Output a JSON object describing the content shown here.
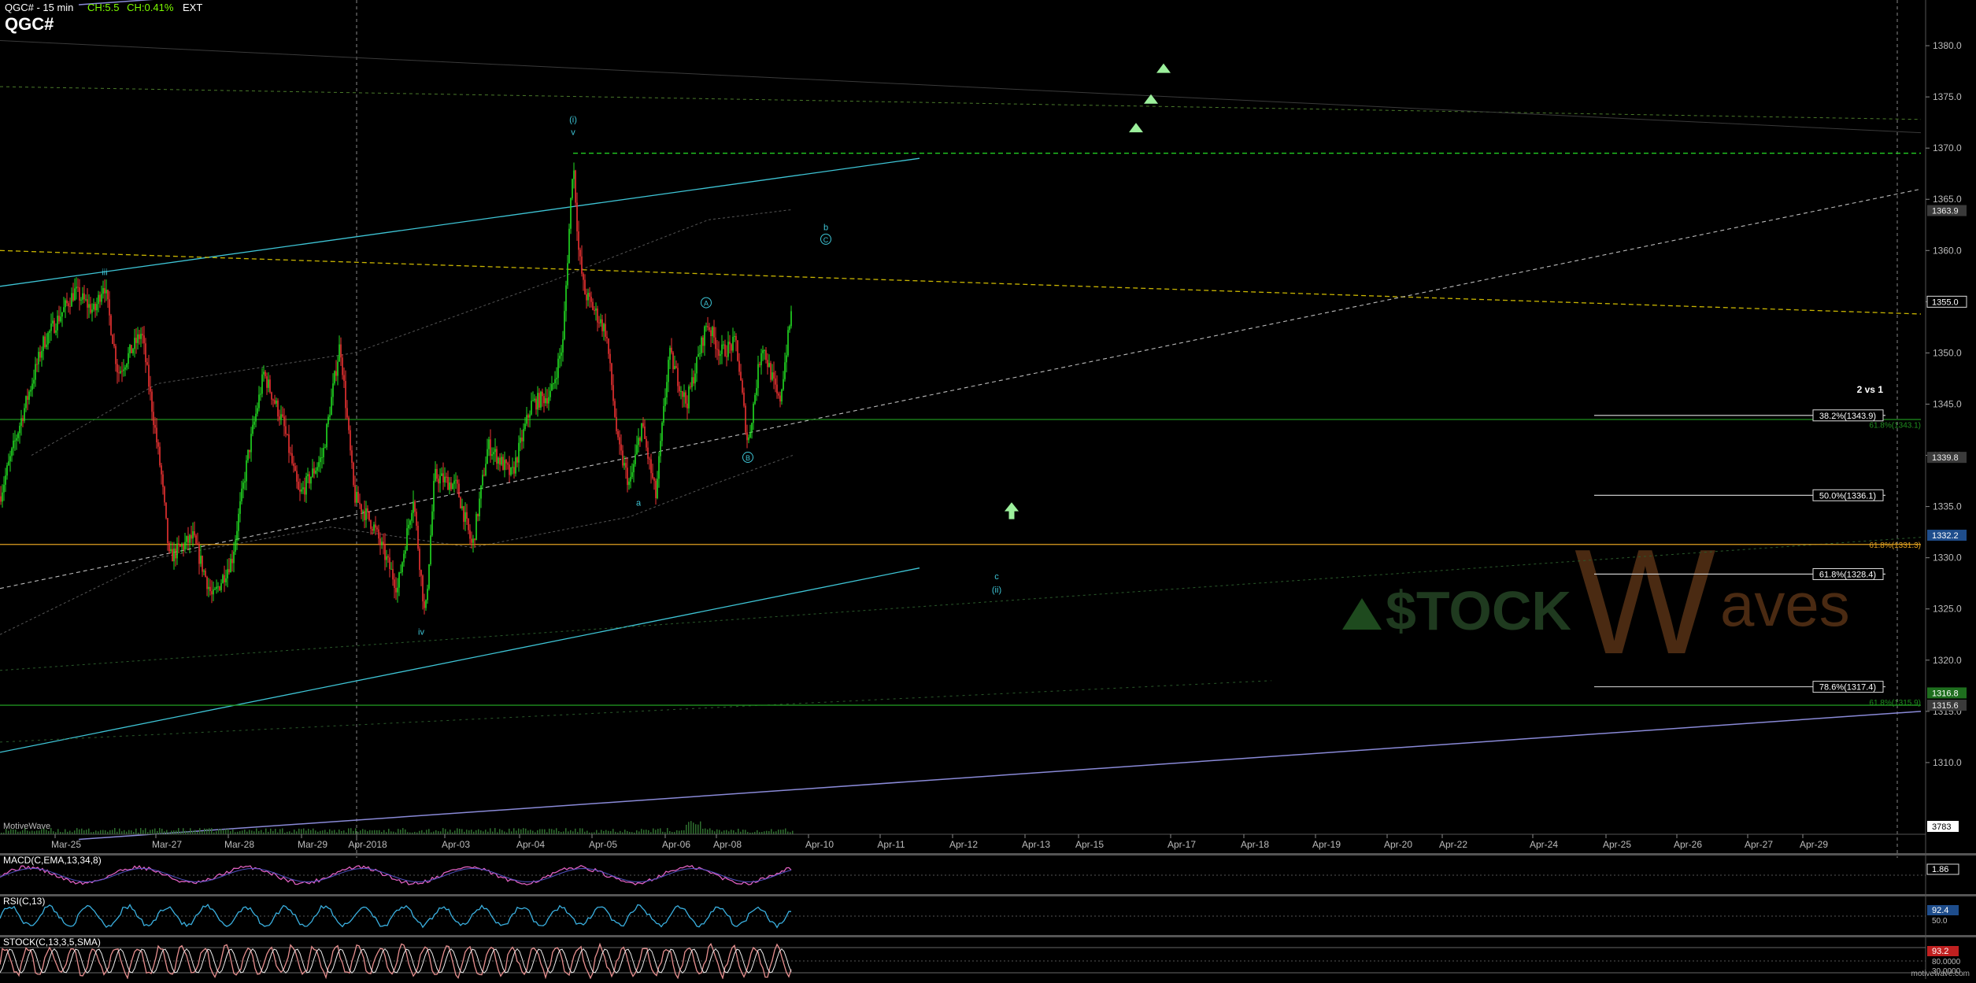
{
  "header": {
    "instrument": "QGC# - 15 min",
    "change_abs": "CH:5.5",
    "change_pct": "CH:0.41%",
    "session": "EXT",
    "symbol": "QGC#"
  },
  "watermark": {
    "brand_left": "$TOCK",
    "brand_right": "aves",
    "logo_letter": "W"
  },
  "source_label": "MotiveWave",
  "footer_url": "motivewave.com",
  "colors": {
    "background": "#000000",
    "bull": "#22dd22",
    "bear": "#ee3333",
    "cyan": "#3ec5d6",
    "green_line": "#22bb22",
    "orange_line": "#e0a020",
    "yellow_dash": "#c8b400",
    "purple_line": "#8a8ad8",
    "macd": "#e060c0",
    "rsi": "#3ab0e0",
    "stoch": "#e89090"
  },
  "chart_data": {
    "type": "candlestick",
    "title": "QGC#",
    "interval": "15 min",
    "ylim": [
      1303,
      1384
    ],
    "y_ticks": [
      1310.0,
      1315.0,
      1320.0,
      1325.0,
      1330.0,
      1335.0,
      1340.0,
      1345.0,
      1350.0,
      1355.0,
      1360.0,
      1365.0,
      1370.0,
      1375.0,
      1380.0
    ],
    "x_tick_labels": [
      "Mar-25",
      "Mar-27",
      "Mar-28",
      "Mar-29",
      "Apr-2018",
      "Apr-03",
      "Apr-04",
      "Apr-05",
      "Apr-06",
      "Apr-08",
      "Apr-10",
      "Apr-11",
      "Apr-12",
      "Apr-13",
      "Apr-15",
      "Apr-17",
      "Apr-18",
      "Apr-19",
      "Apr-20",
      "Apr-22",
      "Apr-24",
      "Apr-25",
      "Apr-26",
      "Apr-27",
      "Apr-29"
    ],
    "price_path": [
      [
        0,
        1336
      ],
      [
        25,
        1343
      ],
      [
        55,
        1351
      ],
      [
        95,
        1356
      ],
      [
        120,
        1354
      ],
      [
        132,
        1357
      ],
      [
        150,
        1348
      ],
      [
        180,
        1352
      ],
      [
        205,
        1338
      ],
      [
        215,
        1330
      ],
      [
        245,
        1332
      ],
      [
        270,
        1326
      ],
      [
        295,
        1330
      ],
      [
        315,
        1340
      ],
      [
        335,
        1348
      ],
      [
        360,
        1343
      ],
      [
        380,
        1336
      ],
      [
        410,
        1340
      ],
      [
        432,
        1351
      ],
      [
        450,
        1336
      ],
      [
        475,
        1333
      ],
      [
        505,
        1327
      ],
      [
        525,
        1336
      ],
      [
        540,
        1324
      ],
      [
        552,
        1338
      ],
      [
        580,
        1337
      ],
      [
        600,
        1331
      ],
      [
        620,
        1341
      ],
      [
        650,
        1338
      ],
      [
        675,
        1345
      ],
      [
        700,
        1346
      ],
      [
        715,
        1351
      ],
      [
        728,
        1369
      ],
      [
        735,
        1360
      ],
      [
        742,
        1356
      ],
      [
        770,
        1352
      ],
      [
        785,
        1341
      ],
      [
        800,
        1337
      ],
      [
        815,
        1343
      ],
      [
        833,
        1336
      ],
      [
        850,
        1350
      ],
      [
        872,
        1345
      ],
      [
        898,
        1353
      ],
      [
        915,
        1350
      ],
      [
        935,
        1351
      ],
      [
        950,
        1341
      ],
      [
        968,
        1351
      ],
      [
        990,
        1345
      ],
      [
        1007,
        1355
      ]
    ],
    "last_price": 1355.0,
    "price_labels": [
      {
        "value": 1363.9,
        "text": "1363.9",
        "style": "gray"
      },
      {
        "value": 1355.0,
        "text": "1355.0",
        "style": "white"
      },
      {
        "value": 1339.8,
        "text": "1339.8",
        "style": "gray"
      },
      {
        "value": 1332.2,
        "text": "1332.2",
        "style": "blue"
      },
      {
        "value": 1316.8,
        "text": "1316.8",
        "style": "green"
      },
      {
        "value": 1315.6,
        "text": "1315.6",
        "style": "gray"
      }
    ],
    "horizontal_levels": [
      {
        "value": 1369.5,
        "color": "#22cc22",
        "style": "dash",
        "x_from": 728
      },
      {
        "value": 1343.5,
        "color": "#1f8f1f",
        "style": "solid",
        "x_from": 0
      },
      {
        "value": 1331.3,
        "color": "#e0a020",
        "style": "solid",
        "x_from": 0
      },
      {
        "value": 1315.6,
        "color": "#1f8f1f",
        "style": "solid",
        "x_from": 0
      }
    ],
    "fib_title": "2 vs 1",
    "fib_levels": [
      {
        "value": 1343.9,
        "label": "38.2%(1343.9)"
      },
      {
        "value": 1336.1,
        "label": "50.0%(1336.1)"
      },
      {
        "value": 1328.4,
        "label": "61.8%(1328.4)"
      },
      {
        "value": 1317.4,
        "label": "78.6%(1317.4)"
      }
    ],
    "fib_side_labels": [
      {
        "value": 1343.0,
        "label": "61.8%(1343.1)",
        "color": "#1f8f1f"
      },
      {
        "value": 1331.3,
        "label": "61.8%(1331.3)",
        "color": "#e0a020"
      },
      {
        "value": 1315.9,
        "label": "61.8%(1315.9)",
        "color": "#1f8f1f"
      }
    ],
    "wave_labels": [
      {
        "x": 133,
        "value": 1357.6,
        "text": "iii"
      },
      {
        "x": 728,
        "value": 1372.5,
        "text": "(i)"
      },
      {
        "x": 728,
        "value": 1371.3,
        "text": "v"
      },
      {
        "x": 535,
        "value": 1322.5,
        "text": "iv"
      },
      {
        "x": 897,
        "value": 1354.6,
        "text": "A",
        "circled": true
      },
      {
        "x": 950,
        "value": 1339.5,
        "text": "B",
        "circled": true
      },
      {
        "x": 1049,
        "value": 1362.0,
        "text": "b"
      },
      {
        "x": 1049,
        "value": 1360.8,
        "text": "C",
        "circled": true
      },
      {
        "x": 811,
        "value": 1335.1,
        "text": "a"
      },
      {
        "x": 1266,
        "value": 1327.9,
        "text": "c"
      },
      {
        "x": 1266,
        "value": 1326.6,
        "text": "(ii)"
      }
    ],
    "target_arrows": [
      {
        "x": 1443,
        "value": 1372.0,
        "direction": "up"
      },
      {
        "x": 1462,
        "value": 1374.8,
        "direction": "up"
      },
      {
        "x": 1478,
        "value": 1377.8,
        "direction": "up"
      },
      {
        "x": 1285,
        "value": 1334.5,
        "direction": "up",
        "style": "outline"
      }
    ],
    "indicators": [
      {
        "name": "MACD(C,EMA,13,34,8)",
        "value_text": "1.86",
        "ref_levels": []
      },
      {
        "name": "RSI(C,13)",
        "value_text": "92.4",
        "ref_levels": [
          "50.0"
        ]
      },
      {
        "name": "STOCK(C,13,3,5,SMA)",
        "value_text": "93.2",
        "ref_levels": [
          "80.0000",
          "30.0000"
        ]
      }
    ],
    "volume_label": "3783"
  }
}
